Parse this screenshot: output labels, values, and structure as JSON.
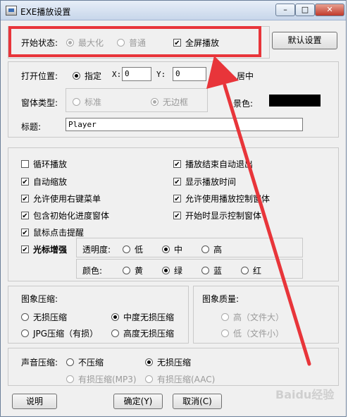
{
  "window": {
    "title": "EXE播放设置",
    "min": "–",
    "max": "□",
    "close": "✕"
  },
  "start_state": {
    "label": "开始状态:",
    "options": [
      {
        "label": "最大化",
        "selected": true
      },
      {
        "label": "普通",
        "selected": false
      }
    ],
    "fullscreen": {
      "label": "全屏播放",
      "checked": true
    }
  },
  "default_button": "默认设置",
  "open_position": {
    "label": "打开位置:",
    "specify": "指定",
    "x_label": "X:",
    "x_value": "0",
    "y_label": "Y:",
    "y_value": "0",
    "center": "居中"
  },
  "window_type": {
    "label": "窗体类型:",
    "standard": "标准",
    "borderless": "无边框",
    "bg_label": "景色:",
    "bg_color": "#000000"
  },
  "title_field": {
    "label": "标题:",
    "value": "Player"
  },
  "options": {
    "left": [
      {
        "label": "循环播放",
        "checked": false
      },
      {
        "label": "自动缩放",
        "checked": true
      },
      {
        "label": "允许使用右键菜单",
        "checked": true
      },
      {
        "label": "包含初始化进度窗体",
        "checked": true
      },
      {
        "label": "鼠标点击提醒",
        "checked": true
      },
      {
        "label": "光标增强",
        "checked": true
      }
    ],
    "right": [
      {
        "label": "播放结束自动退出",
        "checked": true
      },
      {
        "label": "显示播放时间",
        "checked": true
      },
      {
        "label": "允许使用播放控制窗体",
        "checked": true
      },
      {
        "label": "开始时显示控制窗体",
        "checked": true
      }
    ]
  },
  "transparency": {
    "label": "透明度:",
    "options": [
      "低",
      "中",
      "高"
    ],
    "selected": 1
  },
  "color": {
    "label": "颜色:",
    "options": [
      "黄",
      "绿",
      "蓝",
      "红"
    ],
    "selected": 1
  },
  "image_compression": {
    "label": "图象压缩:",
    "lossless": "无损压缩",
    "medium": "中度无损压缩",
    "jpg": "JPG压缩（有损）",
    "high": "高度无损压缩"
  },
  "image_quality": {
    "label": "图象质量:",
    "high": "高（文件大）",
    "low": "低（文件小）"
  },
  "sound_compression": {
    "label": "声音压缩:",
    "none": "不压缩",
    "lossless": "无损压缩",
    "mp3": "有损压缩(MP3)",
    "aac": "有损压缩(AAC)"
  },
  "footer": {
    "help": "说明",
    "ok": "确定(Y)",
    "cancel": "取消(C)"
  },
  "watermark": "Baidu经验"
}
